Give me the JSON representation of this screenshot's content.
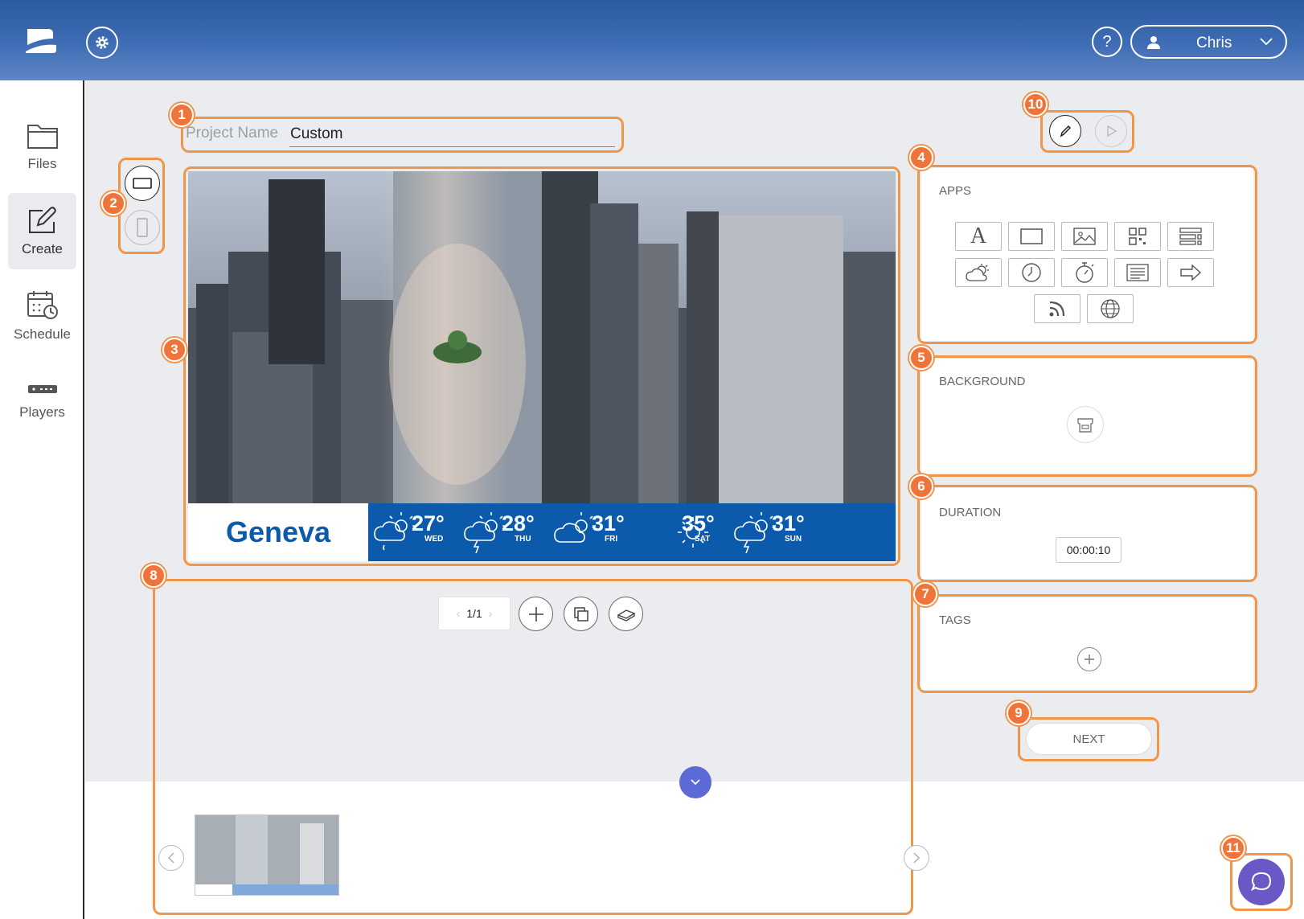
{
  "header": {
    "user_name": "Chris",
    "help_label": "?"
  },
  "sidebar": {
    "items": [
      {
        "label": "Files",
        "icon": "folder-icon"
      },
      {
        "label": "Create",
        "icon": "edit-icon",
        "active": true
      },
      {
        "label": "Schedule",
        "icon": "calendar-clock-icon"
      },
      {
        "label": "Players",
        "icon": "player-device-icon"
      }
    ]
  },
  "project": {
    "name_label": "Project Name",
    "name_value": "Custom"
  },
  "canvas": {
    "city": "Geneva",
    "forecast": [
      {
        "temp": "27°",
        "day": "WED",
        "icon": "rain-sun-icon"
      },
      {
        "temp": "28°",
        "day": "THU",
        "icon": "storm-sun-icon"
      },
      {
        "temp": "31°",
        "day": "FRI",
        "icon": "cloud-sun-icon"
      },
      {
        "temp": "35°",
        "day": "SAT",
        "icon": "sun-icon"
      },
      {
        "temp": "31°",
        "day": "SUN",
        "icon": "storm-sun-icon"
      }
    ]
  },
  "panels": {
    "apps_title": "APPS",
    "apps": [
      "text-icon",
      "rectangle-icon",
      "image-icon",
      "qr-code-icon",
      "list-layout-icon",
      "weather-icon",
      "clock-icon",
      "timer-icon",
      "text-block-icon",
      "arrow-icon",
      "rss-icon",
      "web-icon"
    ],
    "background_title": "BACKGROUND",
    "duration_title": "DURATION",
    "duration_value": "00:00:10",
    "tags_title": "TAGS",
    "next_label": "NEXT"
  },
  "pager": {
    "page": "1/1"
  },
  "badges": [
    "1",
    "2",
    "3",
    "4",
    "5",
    "6",
    "7",
    "8",
    "9",
    "10",
    "11"
  ],
  "colors": {
    "accent": "#f0964a",
    "badge": "#f0743a",
    "header": "#2c5aa0",
    "weather_bar": "#0b5aab",
    "chat": "#6a58c7",
    "collapse": "#5b6ad6"
  }
}
